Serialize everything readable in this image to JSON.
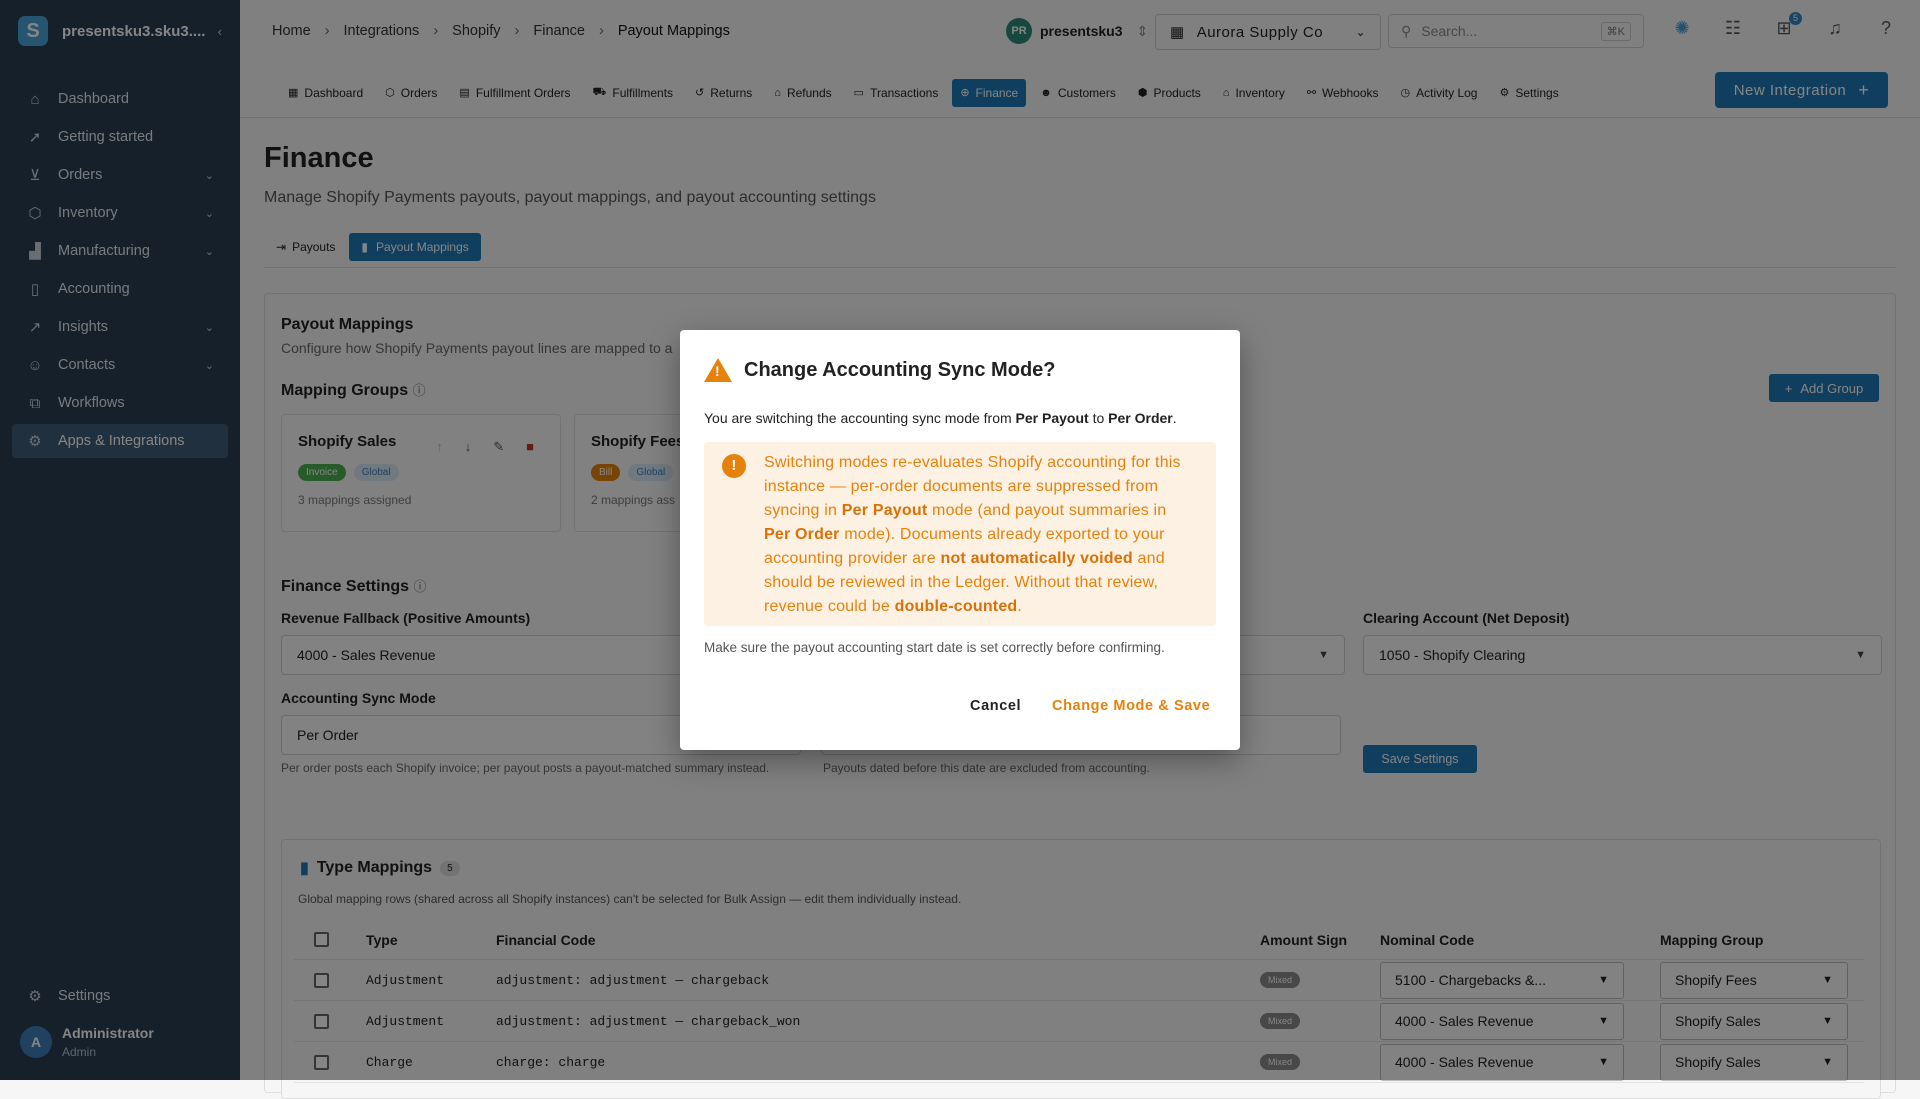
{
  "sidebar": {
    "title": "presentsku3.sku3....",
    "logo": "S",
    "items": [
      {
        "label": "Dashboard",
        "icon": "home-icon"
      },
      {
        "label": "Getting started",
        "icon": "rocket-icon"
      },
      {
        "label": "Orders",
        "icon": "cart-icon"
      },
      {
        "label": "Inventory",
        "icon": "box-icon"
      },
      {
        "label": "Manufacturing",
        "icon": "factory-icon"
      },
      {
        "label": "Accounting",
        "icon": "book-icon"
      },
      {
        "label": "Insights",
        "icon": "chart-icon"
      },
      {
        "label": "Contacts",
        "icon": "contacts-icon"
      },
      {
        "label": "Workflows",
        "icon": "workflow-icon"
      },
      {
        "label": "Apps & Integrations",
        "icon": "apps-icon"
      }
    ],
    "settings_label": "Settings",
    "user": {
      "initial": "A",
      "name": "Administrator",
      "role": "Admin"
    }
  },
  "topbar": {
    "breadcrumbs": [
      "Home",
      "Integrations",
      "Shopify",
      "Finance",
      "Payout Mappings"
    ],
    "user_initials": "PR",
    "user_name": "presentsku3",
    "company": "Aurora Supply Co",
    "search_placeholder": "Search...",
    "search_shortcut": "⌘K",
    "gift_badge": "5"
  },
  "tabs": [
    {
      "label": "Dashboard"
    },
    {
      "label": "Orders"
    },
    {
      "label": "Fulfillment Orders"
    },
    {
      "label": "Fulfillments"
    },
    {
      "label": "Returns"
    },
    {
      "label": "Refunds"
    },
    {
      "label": "Transactions"
    },
    {
      "label": "Finance"
    },
    {
      "label": "Customers"
    },
    {
      "label": "Products"
    },
    {
      "label": "Inventory"
    },
    {
      "label": "Webhooks"
    },
    {
      "label": "Activity Log"
    },
    {
      "label": "Settings"
    }
  ],
  "new_integration": "New Integration",
  "page": {
    "title": "Finance",
    "subtitle": "Manage Shopify Payments payouts, payout mappings, and payout accounting settings",
    "subtabs": [
      "Payouts",
      "Payout Mappings"
    ]
  },
  "payout_mappings": {
    "title": "Payout Mappings",
    "description": "Configure how Shopify Payments payout lines are mapped to a",
    "groups_title": "Mapping Groups",
    "add_group": "Add Group",
    "groups": [
      {
        "name": "Shopify Sales",
        "chip1": "Invoice",
        "chip2": "Global",
        "meta": "3 mappings assigned"
      },
      {
        "name": "Shopify Fees",
        "chip1": "Bill",
        "chip2": "Global",
        "meta": "2 mappings ass"
      }
    ]
  },
  "finance_settings": {
    "title": "Finance Settings",
    "revenue_label": "Revenue Fallback (Positive Amounts)",
    "revenue_value": "4000 - Sales Revenue",
    "clearing_label": "Clearing Account (Net Deposit)",
    "clearing_value": "1050 - Shopify Clearing",
    "sync_label": "Accounting Sync Mode",
    "sync_value": "Per Order",
    "sync_help": "Per order posts each Shopify invoice; per payout posts a payout-matched summary instead.",
    "date_help": "Payouts dated before this date are excluded from accounting.",
    "save": "Save Settings"
  },
  "type_mappings": {
    "title": "Type Mappings",
    "count": "5",
    "note": "Global mapping rows (shared across all Shopify instances) can't be selected for Bulk Assign — edit them individually instead.",
    "headers": [
      "Type",
      "Financial Code",
      "Amount Sign",
      "Nominal Code",
      "Mapping Group"
    ],
    "rows": [
      {
        "type": "Adjustment",
        "code": "adjustment: adjustment — chargeback",
        "sign": "Mixed",
        "nominal": "5100 - Chargebacks &...",
        "group": "Shopify Fees"
      },
      {
        "type": "Adjustment",
        "code": "adjustment: adjustment — chargeback_won",
        "sign": "Mixed",
        "nominal": "4000 - Sales Revenue",
        "group": "Shopify Sales"
      },
      {
        "type": "Charge",
        "code": "charge: charge",
        "sign": "Mixed",
        "nominal": "4000 - Sales Revenue",
        "group": "Shopify Sales"
      }
    ]
  },
  "modal": {
    "title": "Change Accounting Sync Mode?",
    "intro_pre": "You are switching the accounting sync mode from ",
    "from": "Per Payout",
    "intro_mid": " to ",
    "to": "Per Order",
    "intro_end": ".",
    "alert_1": "Switching modes re-evaluates Shopify accounting for this instance — per-order documents are suppressed from syncing in ",
    "alert_b1": "Per Payout",
    "alert_2": " mode (and payout summaries in ",
    "alert_b2": "Per Order",
    "alert_3": " mode). Documents already exported to your accounting provider are ",
    "alert_b3": "not automatically voided",
    "alert_4": " and should be reviewed in the Ledger. Without that review, revenue could be ",
    "alert_b4": "double-counted",
    "alert_5": ".",
    "footer": "Make sure the payout accounting start date is set correctly before confirming.",
    "cancel": "Cancel",
    "confirm": "Change Mode & Save"
  },
  "colors": {
    "accent": "#1f78b4",
    "warning": "#e6820b",
    "sidebar": "#2a3e52"
  }
}
